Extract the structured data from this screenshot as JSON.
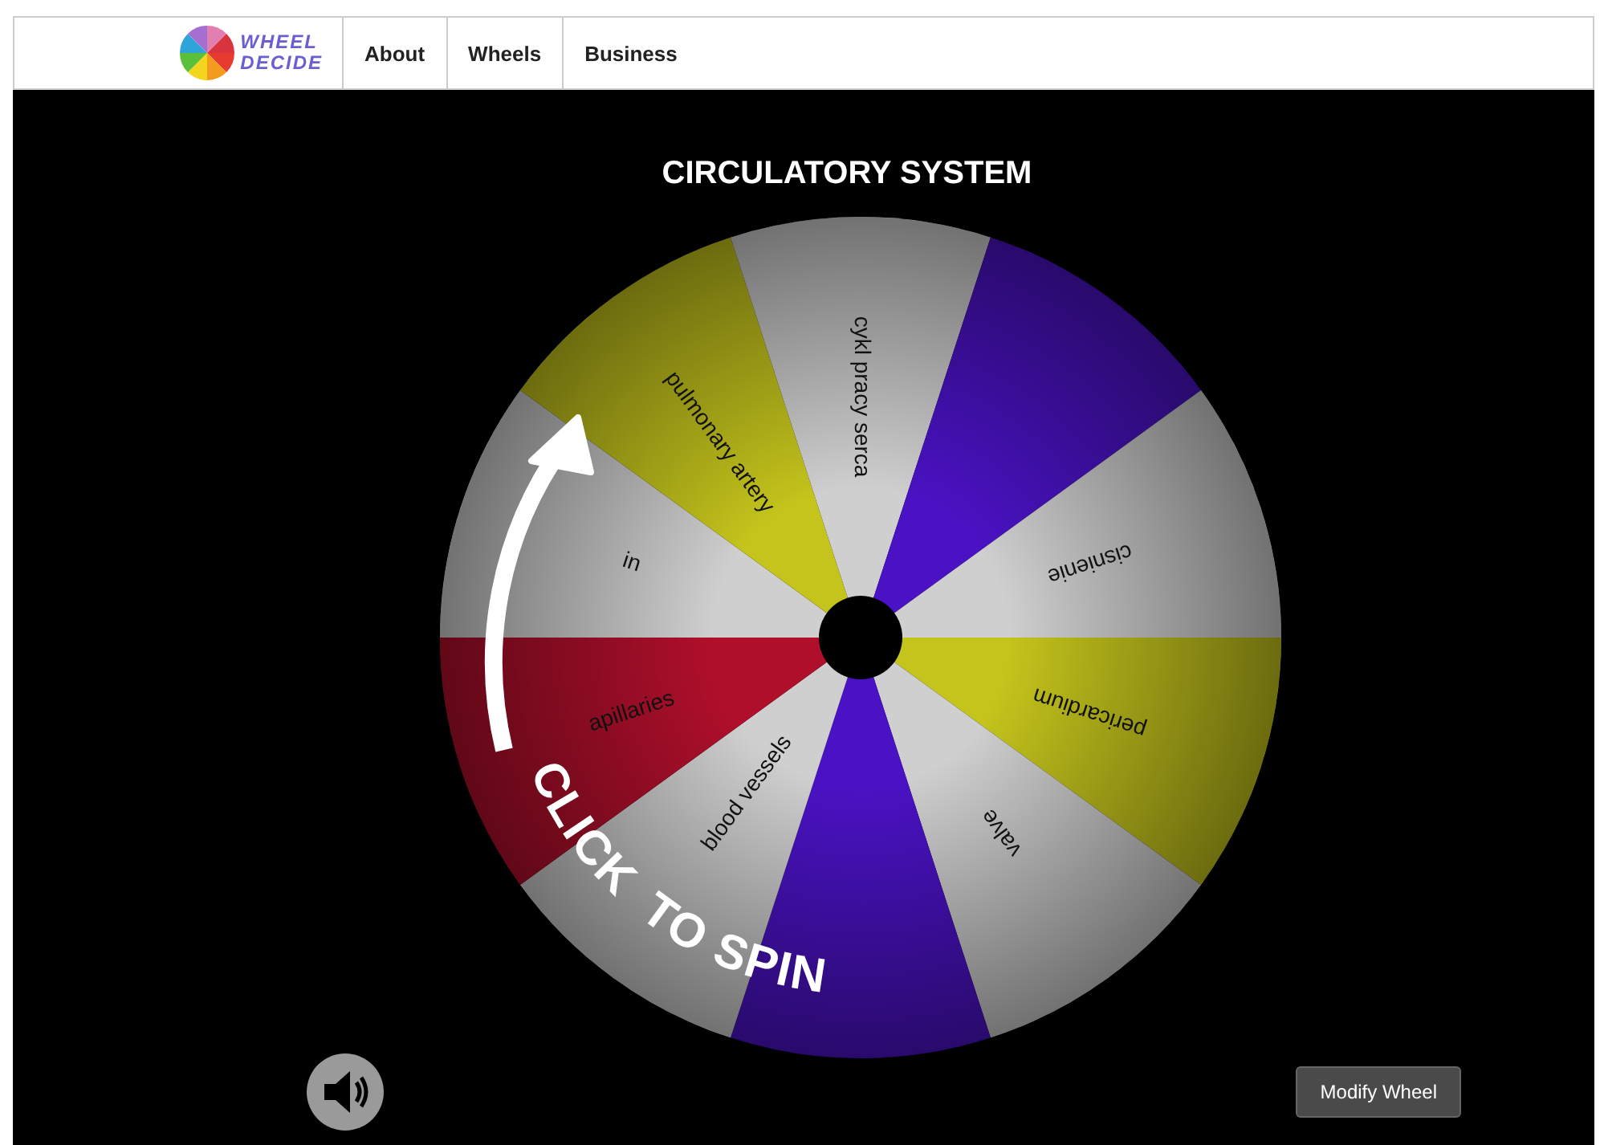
{
  "logo": {
    "line_1": "WHEEL",
    "line_2": "DECIDE"
  },
  "nav": [
    {
      "label": "About"
    },
    {
      "label": "Wheels"
    },
    {
      "label": "Business"
    }
  ],
  "title": "CIRCULATORY SYSTEM",
  "wheel": {
    "segments": [
      {
        "label": "pericardium",
        "color": "#c4c41c"
      },
      {
        "label": "valve",
        "color": "#cfcfcf"
      },
      {
        "color": "#4a12c4"
      },
      {
        "label": "blood vessels",
        "color": "#cfcfcf"
      },
      {
        "label": "apillaries",
        "color": "#b00f2b"
      },
      {
        "label": "in",
        "color": "#cfcfcf"
      },
      {
        "label": "pulmonary artery",
        "color": "#c4c41c"
      },
      {
        "label": "cykl pracy serca",
        "color": "#cfcfcf"
      },
      {
        "color": "#4a12c4"
      },
      {
        "label": "cisnienie",
        "color": "#cfcfcf"
      }
    ],
    "spin_prompt_words": [
      "CLICK",
      "TO",
      "SPIN"
    ]
  },
  "modify_button": "Modify Wheel"
}
